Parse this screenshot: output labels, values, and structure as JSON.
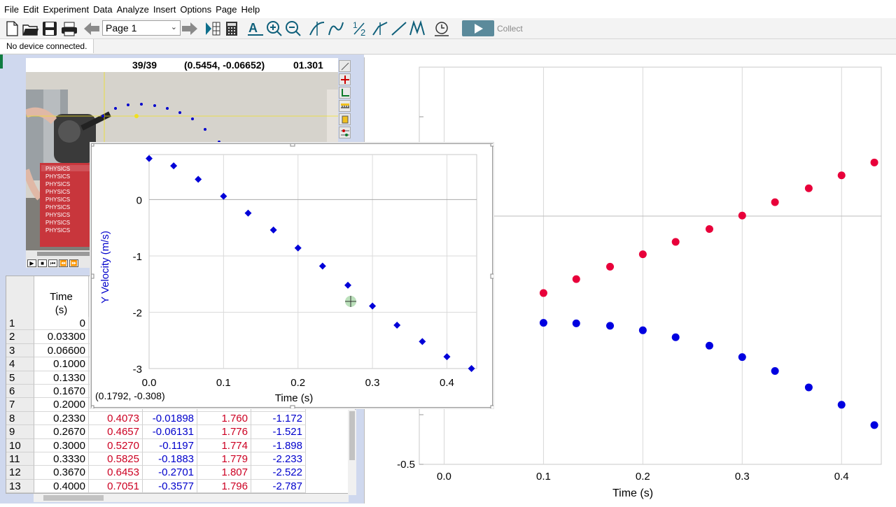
{
  "menu": [
    "File",
    "Edit",
    "Experiment",
    "Data",
    "Analyze",
    "Insert",
    "Options",
    "Page",
    "Help"
  ],
  "toolbar": {
    "page_select": "Page 1",
    "collect_label": "Collect",
    "icons": [
      "new-file-icon",
      "open-folder-icon",
      "save-icon",
      "print-icon",
      "back-arrow-icon",
      "forward-arrow-icon",
      "video-analysis-icon",
      "calculator-icon",
      "autoscale-icon",
      "zoom-in-icon",
      "zoom-out-icon",
      "examine-icon",
      "tangent-icon",
      "integral-icon",
      "stats-icon",
      "linear-fit-icon",
      "curve-fit-icon",
      "replay-icon",
      "play-icon"
    ]
  },
  "status": {
    "text": "No device connected."
  },
  "video": {
    "frame_counter": "39/39",
    "coordinate": "(0.5454, -0.06652)",
    "time": "01.301",
    "book_label": "PHYSICS",
    "trajectory_color": "#0000cc",
    "marker_color": "#f0e020"
  },
  "table": {
    "header_time": "Time",
    "header_time_unit": "(s)",
    "rows": [
      {
        "n": "1",
        "time": "0",
        "c2": "",
        "c3": "",
        "c4": "",
        "c5": ""
      },
      {
        "n": "2",
        "time": "0.03300",
        "c2": "",
        "c3": "",
        "c4": "",
        "c5": ""
      },
      {
        "n": "3",
        "time": "0.06600",
        "c2": "",
        "c3": "",
        "c4": "",
        "c5": ""
      },
      {
        "n": "4",
        "time": "0.1000",
        "c2": "",
        "c3": "",
        "c4": "",
        "c5": ""
      },
      {
        "n": "5",
        "time": "0.1330",
        "c2": "",
        "c3": "",
        "c4": "",
        "c5": ""
      },
      {
        "n": "6",
        "time": "0.1670",
        "c2": "",
        "c3": "",
        "c4": "",
        "c5": ""
      },
      {
        "n": "7",
        "time": "0.2000",
        "c2": "",
        "c3": "",
        "c4": "",
        "c5": ""
      },
      {
        "n": "8",
        "time": "0.2330",
        "c2": "0.4073",
        "c3": "-0.01898",
        "c4": "1.760",
        "c5": "-1.172"
      },
      {
        "n": "9",
        "time": "0.2670",
        "c2": "0.4657",
        "c3": "-0.06131",
        "c4": "1.776",
        "c5": "-1.521"
      },
      {
        "n": "10",
        "time": "0.3000",
        "c2": "0.5270",
        "c3": "-0.1197",
        "c4": "1.774",
        "c5": "-1.898"
      },
      {
        "n": "11",
        "time": "0.3330",
        "c2": "0.5825",
        "c3": "-0.1883",
        "c4": "1.779",
        "c5": "-2.233"
      },
      {
        "n": "12",
        "time": "0.3670",
        "c2": "0.6453",
        "c3": "-0.2701",
        "c4": "1.807",
        "c5": "-2.522"
      },
      {
        "n": "13",
        "time": "0.4000",
        "c2": "0.7051",
        "c3": "-0.3577",
        "c4": "1.796",
        "c5": "-2.787"
      }
    ],
    "colors": {
      "red": "#cc0022",
      "blue": "#0000cc"
    }
  },
  "chart_data": [
    {
      "type": "scatter",
      "xlabel": "Time (s)",
      "ylabel": "",
      "xlim": [
        -0.025,
        0.44
      ],
      "ylim": [
        -0.5,
        0.3
      ],
      "xticks": [
        "0.0",
        "0.1",
        "0.2",
        "0.3",
        "0.4"
      ],
      "yticks": [
        "-0.5"
      ],
      "series": [
        {
          "color": "#e8003a",
          "x": [
            0.1,
            0.133,
            0.167,
            0.2,
            0.233,
            0.267,
            0.3,
            0.333,
            0.367,
            0.4,
            0.433
          ],
          "y": [
            -0.155,
            -0.127,
            -0.102,
            -0.077,
            -0.052,
            -0.026,
            0.001,
            0.028,
            0.056,
            0.082,
            0.108
          ]
        },
        {
          "color": "#0000e0",
          "x": [
            0.1,
            0.133,
            0.167,
            0.2,
            0.233,
            0.267,
            0.3,
            0.333,
            0.367,
            0.4,
            0.433
          ],
          "y": [
            -0.215,
            -0.216,
            -0.221,
            -0.23,
            -0.244,
            -0.261,
            -0.284,
            -0.312,
            -0.345,
            -0.38,
            -0.421
          ]
        }
      ]
    },
    {
      "type": "scatter",
      "xlabel": "Time (s)",
      "ylabel": "Y Velocity (m/s)",
      "xlim": [
        0,
        0.44
      ],
      "ylim": [
        -3,
        0.8
      ],
      "xticks": [
        "0.0",
        "0.1",
        "0.2",
        "0.3",
        "0.4"
      ],
      "yticks": [
        "0",
        "-1",
        "-2",
        "-3"
      ],
      "examine_readout": "(0.1792, -0.308)",
      "series": [
        {
          "color": "#0000d8",
          "x": [
            0.0,
            0.033,
            0.066,
            0.1,
            0.133,
            0.167,
            0.2,
            0.233,
            0.267,
            0.3,
            0.333,
            0.367,
            0.4,
            0.433
          ],
          "y": [
            0.73,
            0.6,
            0.36,
            0.06,
            -0.24,
            -0.54,
            -0.86,
            -1.18,
            -1.52,
            -1.89,
            -2.23,
            -2.52,
            -2.79,
            -3.0
          ]
        }
      ]
    }
  ]
}
